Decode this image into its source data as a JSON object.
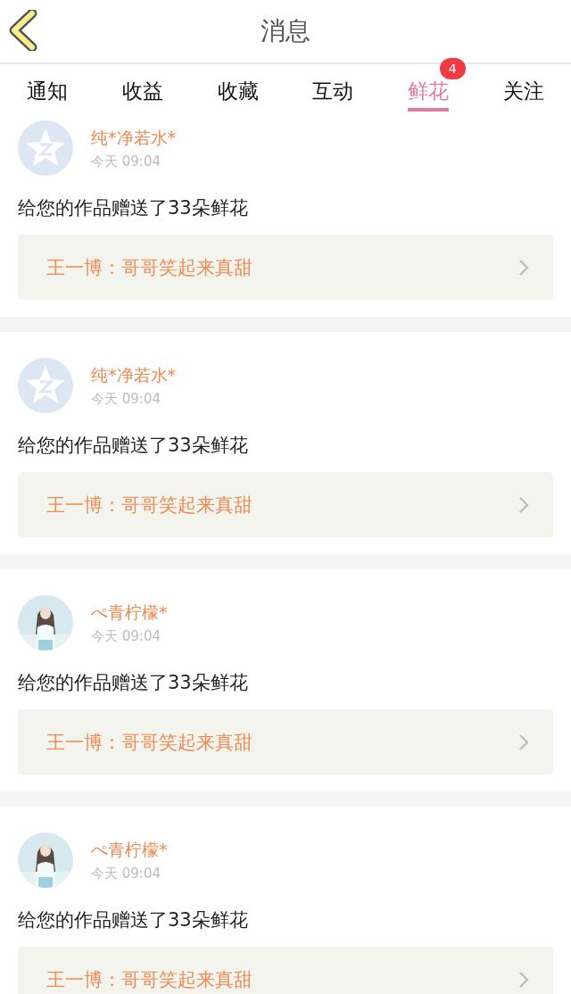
{
  "header": {
    "title": "消息"
  },
  "tabs": [
    {
      "label": "通知",
      "selected": false
    },
    {
      "label": "收益",
      "selected": false
    },
    {
      "label": "收藏",
      "selected": false
    },
    {
      "label": "互动",
      "selected": false
    },
    {
      "label": "鲜花",
      "selected": true,
      "badge": "4"
    },
    {
      "label": "关注",
      "selected": false
    }
  ],
  "messages": [
    {
      "avatar": {
        "kind": "default"
      },
      "name": "纯*净若水*",
      "time": "今天 09:04",
      "text": "给您的作品赠送了33朵鲜花",
      "work": "王一博：哥哥笑起来真甜"
    },
    {
      "avatar": {
        "kind": "default"
      },
      "name": "纯*净若水*",
      "time": "今天 09:04",
      "text": "给您的作品赠送了33朵鲜花",
      "work": "王一博：哥哥笑起来真甜"
    },
    {
      "name": "ぺ青柠檬*",
      "time": "今天 09:04",
      "text": "给您的作品赠送了33朵鲜花",
      "work": "王一博：哥哥笑起来真甜"
    },
    {
      "name": "ぺ青柠檬*",
      "time": "今天 09:04",
      "text": "给您的作品赠送了33朵鲜花",
      "work": "王一博：哥哥笑起来真甜"
    }
  ]
}
